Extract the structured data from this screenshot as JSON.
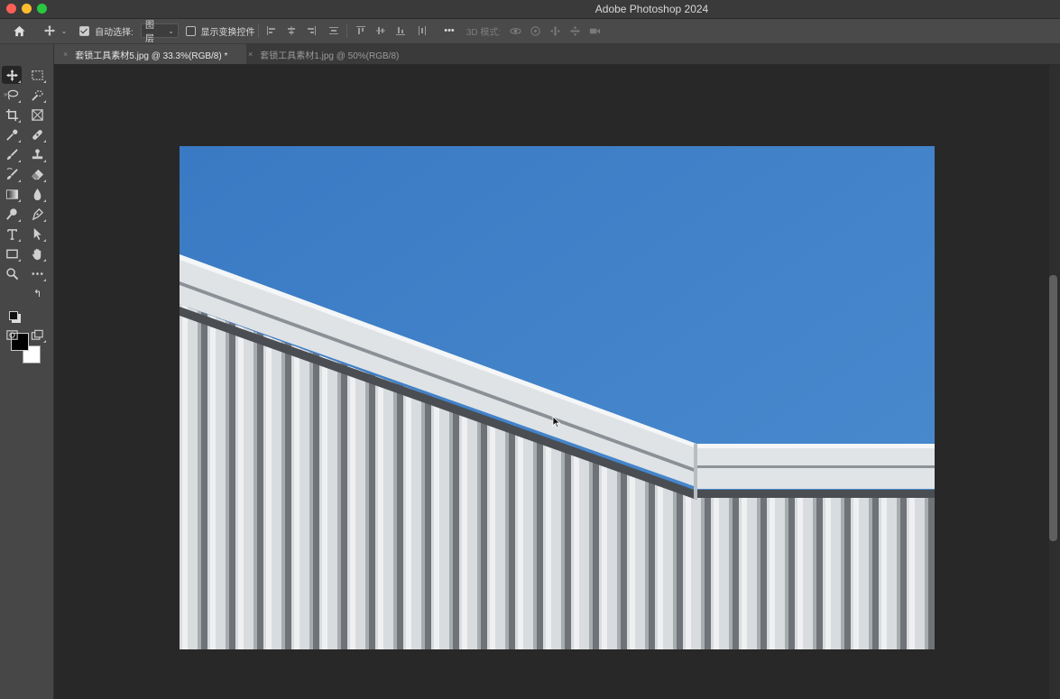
{
  "app": {
    "title": "Adobe Photoshop 2024"
  },
  "options_bar": {
    "auto_select_label": "自动选择:",
    "auto_select_checked": true,
    "auto_select_target": "图层",
    "show_transform_label": "显示变换控件",
    "show_transform_checked": false,
    "more_label": "•••",
    "mode_3d_label": "3D 模式:"
  },
  "tabs": [
    {
      "label": "套锁工具素材5.jpg @ 33.3%(RGB/8) *",
      "active": true
    },
    {
      "label": "套锁工具素材1.jpg @ 50%(RGB/8)",
      "active": false
    }
  ],
  "tools": [
    "move-tool",
    "artboard-marquee-tool",
    "lasso-tool",
    "quick-selection-tool",
    "crop-tool",
    "frame-tool",
    "eyedropper-tool",
    "spot-healing-tool",
    "brush-tool",
    "clone-stamp-tool",
    "history-brush-tool",
    "eraser-tool",
    "gradient-tool",
    "blur-tool",
    "dodge-tool",
    "pen-tool",
    "type-tool",
    "path-selection-tool",
    "rectangle-tool",
    "hand-tool",
    "zoom-tool",
    "more-tools"
  ],
  "colors": {
    "foreground": "#000000",
    "background": "#ffffff",
    "sky": "#4080c6",
    "panel": "#474747",
    "canvas_bg": "#282828"
  }
}
